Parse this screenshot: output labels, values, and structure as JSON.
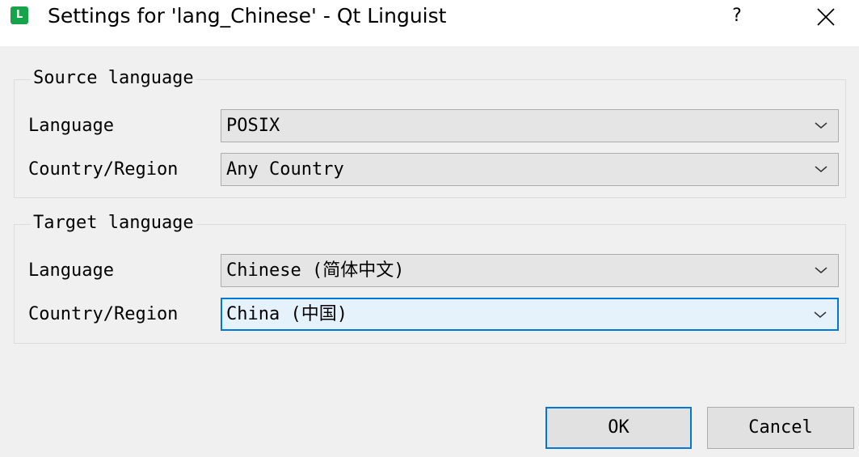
{
  "window": {
    "title": "Settings for 'lang_Chinese' - Qt Linguist",
    "app_icon_letter": "L",
    "app_icon_color": "#17a34a",
    "help_label": "?",
    "close_icon": "close-icon"
  },
  "source_group": {
    "title": "Source language",
    "language_label": "Language",
    "language_value": "POSIX",
    "country_label": "Country/Region",
    "country_value": "Any Country"
  },
  "target_group": {
    "title": "Target language",
    "language_label": "Language",
    "language_value": "Chinese (简体中文)",
    "country_label": "Country/Region",
    "country_value": "China (中国)"
  },
  "buttons": {
    "ok_label": "OK",
    "cancel_label": "Cancel"
  },
  "colors": {
    "accent": "#0078d7",
    "focused_combo_bg": "#e5f1fb",
    "combo_bg": "#e5e5e5",
    "button_bg": "#e1e1e1",
    "dialog_bg": "#f0f0f0"
  }
}
